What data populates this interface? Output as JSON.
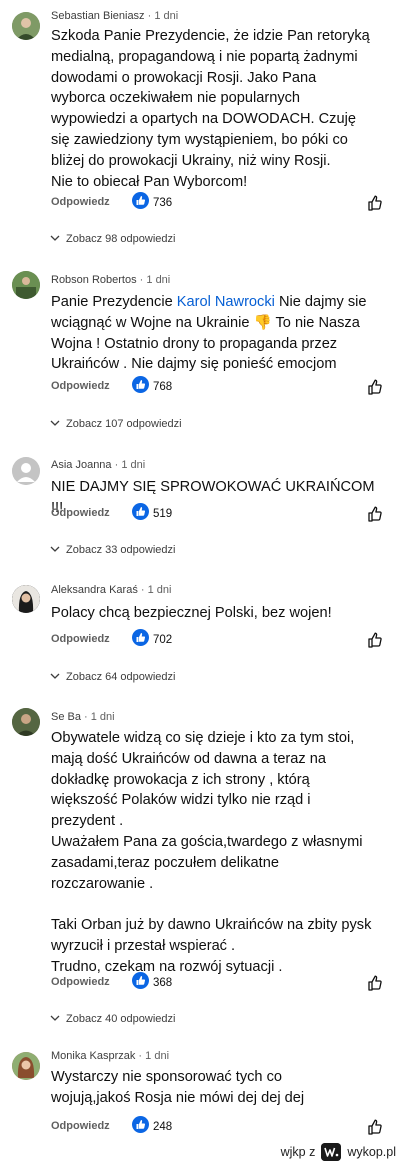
{
  "comments": [
    {
      "author": "Sebastian Bieniasz",
      "time": "1 dni",
      "text": "Szkoda Panie Prezydencie, że idzie Pan retoryką\nmedialną, propagandową i nie popartą żadnymi\ndowodami o prowokacji Rosji. Jako Pana\nwyborca oczekiwałem nie popularnych\nwypowiedzi a opartych na DOWODACH. Czuję\nsię zawiedziony tym wystąpieniem, bo póki co\nbliżej do prowokacji Ukrainy, niż winy Rosji.\nNie to obiecał Pan Wyborcom!",
      "reply_label": "Odpowiedz",
      "likes": "736",
      "replies_label": "Zobacz 98 odpowiedzi",
      "avatar_color": "#6f8a5a"
    },
    {
      "author": "Robson Robertos",
      "time": "1 dni",
      "text_before": "Panie Prezydencie ",
      "mention": "Karol Nawrocki",
      "text_after": " Nie dajmy sie\nwciągnąć w Wojne na Ukrainie 👎 To nie Nasza\nWojna ! Ostatnio drony to propaganda przez\nUkraińców . Nie dajmy się ponieść emocjom",
      "reply_label": "Odpowiedz",
      "likes": "768",
      "replies_label": "Zobacz 107 odpowiedzi",
      "avatar_color": "#5b7a48"
    },
    {
      "author": "Asia Joanna",
      "time": "1 dni",
      "text": "NIE DAJMY SIĘ SPROWOKOWAĆ UKRAIŃCOM !!!",
      "reply_label": "Odpowiedz",
      "likes": "519",
      "replies_label": "Zobacz 33 odpowiedzi",
      "avatar_color": "#c7c7c7"
    },
    {
      "author": "Aleksandra Karaś",
      "time": "1 dni",
      "text": "Polacy chcą bezpiecznej Polski, bez wojen!",
      "reply_label": "Odpowiedz",
      "likes": "702",
      "replies_label": "Zobacz 64 odpowiedzi",
      "avatar_color": "#2b2b2b"
    },
    {
      "author": "Se Ba",
      "time": "1 dni",
      "text": "Obywatele widzą co się dzieje i kto za tym stoi,\nmają dość Ukraińców od dawna a teraz na\ndokładkę prowokacja z ich strony , którą\nwiększość Polaków widzi tylko nie rząd i\nprezydent .\nUważałem Pana za gościa,twardego z własnymi\nzasadami,teraz poczułem delikatne\nrozczarowanie .\n\nTaki Orban już by dawno Ukraińców na zbity pysk\nwyrzucił i przestał wspierać .\nTrudno, czekam na rozwój sytuacji .",
      "reply_label": "Odpowiedz",
      "likes": "368",
      "replies_label": "Zobacz 40 odpowiedzi",
      "avatar_color": "#4e5a3c"
    },
    {
      "author": "Monika Kasprzak",
      "time": "1 dni",
      "text": "Wystarczy nie sponsorować tych co\nwojują,jakoś Rosja nie mówi dej dej dej",
      "reply_label": "Odpowiedz",
      "likes": "248",
      "avatar_color": "#a0735a"
    }
  ],
  "footer": {
    "label": "wjkp z",
    "brand": "wykop.pl"
  },
  "colors": {
    "like_blue": "#0b66e4",
    "mention_blue": "#065fd4"
  }
}
